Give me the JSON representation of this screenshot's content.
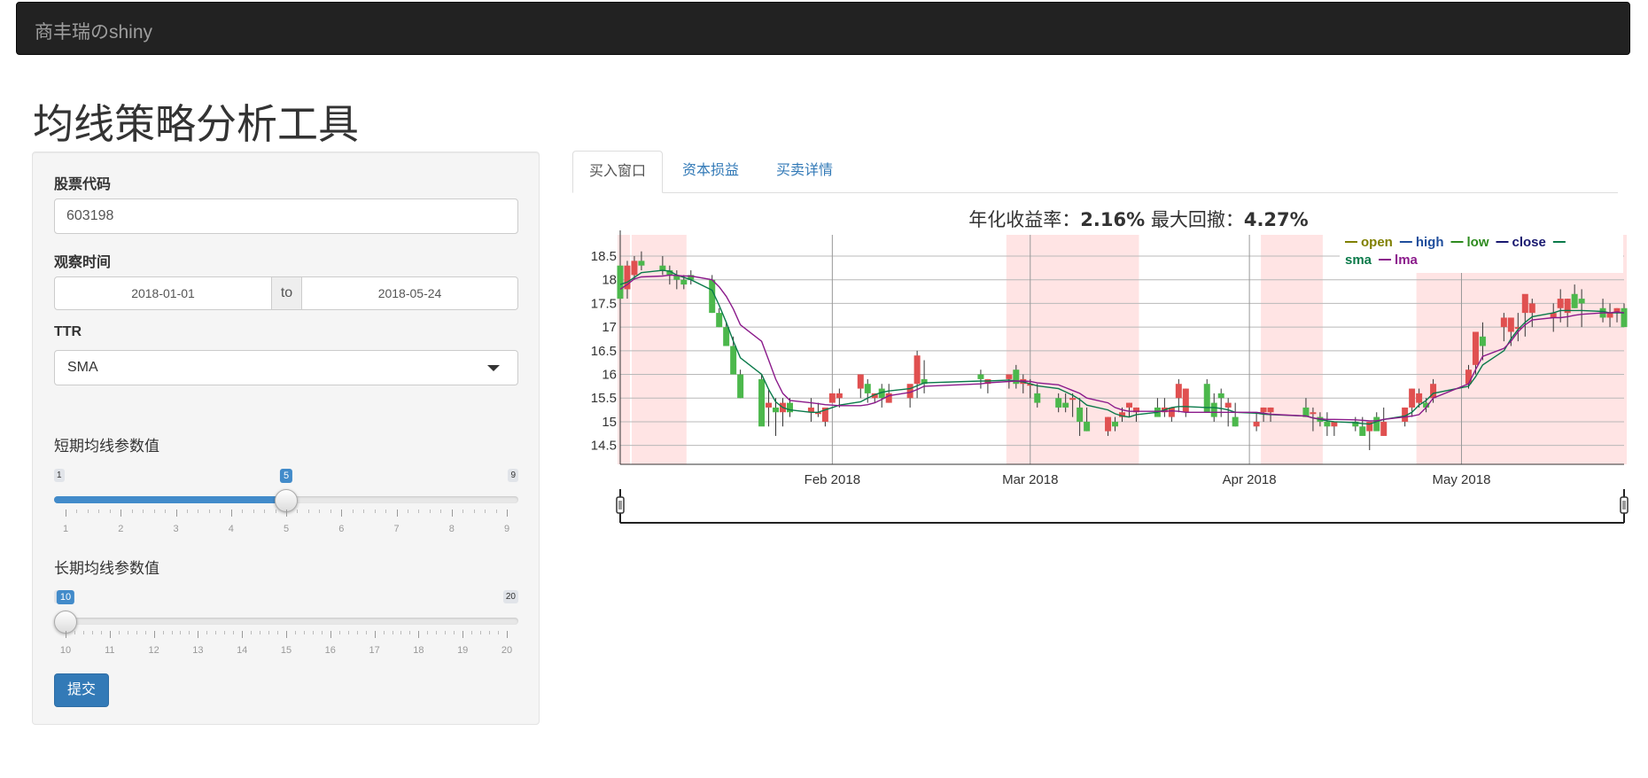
{
  "navbar": {
    "brand": "商丰瑞のshiny"
  },
  "page": {
    "title": "均线策略分析工具"
  },
  "sidebar": {
    "stock_code_label": "股票代码",
    "stock_code_value": "603198",
    "date_label": "观察时间",
    "date_start": "2018-01-01",
    "date_sep": "to",
    "date_end": "2018-05-24",
    "ttr_label": "TTR",
    "ttr_selected": "SMA",
    "short_label": "短期均线参数值",
    "short_slider": {
      "min": 1,
      "max": 9,
      "value": 5,
      "ticks": [
        "1",
        "2",
        "3",
        "4",
        "5",
        "6",
        "7",
        "8",
        "9"
      ]
    },
    "long_label": "长期均线参数值",
    "long_slider": {
      "min": 10,
      "max": 20,
      "value": 10,
      "ticks": [
        "10",
        "11",
        "12",
        "13",
        "14",
        "15",
        "16",
        "17",
        "18",
        "19",
        "20"
      ]
    },
    "submit_label": "提交"
  },
  "tabs": [
    {
      "label": "买入窗口",
      "active": true
    },
    {
      "label": "资本损益",
      "active": false
    },
    {
      "label": "买卖详情",
      "active": false
    }
  ],
  "chart_data": {
    "type": "candlestick",
    "title_prefix": "年化收益率：",
    "annual_return": "2.16%",
    "title_mid": " 最大回撤：",
    "max_drawdown": "4.27%",
    "legend": [
      {
        "name": "open",
        "color": "#808000"
      },
      {
        "name": "high",
        "color": "#1f4e9c"
      },
      {
        "name": "low",
        "color": "#2e8b1f"
      },
      {
        "name": "close",
        "color": "#191970"
      },
      {
        "name": "sma",
        "color": "#0a7a4a"
      },
      {
        "name": "lma",
        "color": "#8b1a8b"
      }
    ],
    "y_ticks": [
      "14.5",
      "15",
      "15.5",
      "16",
      "16.5",
      "17",
      "17.5",
      "18",
      "18.5"
    ],
    "ylim": [
      14.1,
      18.95
    ],
    "x_ticks": [
      {
        "label": "Feb 2018",
        "date": "2018-02-01"
      },
      {
        "label": "Mar 2018",
        "date": "2018-03-01"
      },
      {
        "label": "Apr 2018",
        "date": "2018-04-01"
      },
      {
        "label": "May 2018",
        "date": "2018-05-01"
      }
    ],
    "xlim": [
      "2018-01-02",
      "2018-05-24"
    ],
    "buy_windows": [
      [
        "2018-01-02",
        "2018-01-03"
      ],
      [
        "2018-01-04",
        "2018-01-11"
      ],
      [
        "2018-02-26",
        "2018-03-16"
      ],
      [
        "2018-04-03",
        "2018-04-11"
      ],
      [
        "2018-04-25",
        "2018-05-24"
      ]
    ],
    "dates": [
      "2018-01-02",
      "2018-01-03",
      "2018-01-04",
      "2018-01-05",
      "2018-01-08",
      "2018-01-09",
      "2018-01-10",
      "2018-01-11",
      "2018-01-12",
      "2018-01-15",
      "2018-01-16",
      "2018-01-17",
      "2018-01-18",
      "2018-01-19",
      "2018-01-22",
      "2018-01-23",
      "2018-01-24",
      "2018-01-25",
      "2018-01-26",
      "2018-01-29",
      "2018-01-30",
      "2018-01-31",
      "2018-02-01",
      "2018-02-02",
      "2018-02-05",
      "2018-02-06",
      "2018-02-07",
      "2018-02-08",
      "2018-02-09",
      "2018-02-12",
      "2018-02-13",
      "2018-02-14",
      "2018-02-22",
      "2018-02-23",
      "2018-02-26",
      "2018-02-27",
      "2018-02-28",
      "2018-03-01",
      "2018-03-02",
      "2018-03-05",
      "2018-03-06",
      "2018-03-07",
      "2018-03-08",
      "2018-03-09",
      "2018-03-12",
      "2018-03-13",
      "2018-03-14",
      "2018-03-15",
      "2018-03-16",
      "2018-03-19",
      "2018-03-20",
      "2018-03-21",
      "2018-03-22",
      "2018-03-23",
      "2018-03-26",
      "2018-03-27",
      "2018-03-28",
      "2018-03-29",
      "2018-03-30",
      "2018-04-02",
      "2018-04-03",
      "2018-04-04",
      "2018-04-09",
      "2018-04-10",
      "2018-04-11",
      "2018-04-12",
      "2018-04-13",
      "2018-04-16",
      "2018-04-17",
      "2018-04-18",
      "2018-04-19",
      "2018-04-20",
      "2018-04-23",
      "2018-04-24",
      "2018-04-25",
      "2018-04-26",
      "2018-04-27",
      "2018-05-02",
      "2018-05-03",
      "2018-05-04",
      "2018-05-07",
      "2018-05-08",
      "2018-05-09",
      "2018-05-10",
      "2018-05-11",
      "2018-05-14",
      "2018-05-15",
      "2018-05-16",
      "2018-05-17",
      "2018-05-18",
      "2018-05-21",
      "2018-05-22",
      "2018-05-23",
      "2018-05-24"
    ],
    "open": [
      18.3,
      17.8,
      18.1,
      18.4,
      18.3,
      18.2,
      18.1,
      18.0,
      18.1,
      18.0,
      17.3,
      17.0,
      16.6,
      16.0,
      15.9,
      15.3,
      15.3,
      15.2,
      15.4,
      15.2,
      15.2,
      15.0,
      15.4,
      15.5,
      15.7,
      15.8,
      15.5,
      15.7,
      15.4,
      15.5,
      15.8,
      15.9,
      16.0,
      15.8,
      15.9,
      16.1,
      15.8,
      15.8,
      15.6,
      15.5,
      15.4,
      15.5,
      15.3,
      15.0,
      14.8,
      15.0,
      15.1,
      15.3,
      15.2,
      15.3,
      15.2,
      15.1,
      15.5,
      15.2,
      15.8,
      15.4,
      15.6,
      15.3,
      15.1,
      14.9,
      15.2,
      15.2,
      15.3,
      15.2,
      15.1,
      15.0,
      14.9,
      15.0,
      14.9,
      14.8,
      15.1,
      14.7,
      15.0,
      15.3,
      15.4,
      15.4,
      15.5,
      15.8,
      16.2,
      16.8,
      17.0,
      16.9,
      17.0,
      17.3,
      17.3,
      17.2,
      17.4,
      17.3,
      17.7,
      17.6,
      17.4,
      17.2,
      17.3,
      17.4
    ],
    "high": [
      18.5,
      18.4,
      18.5,
      18.6,
      18.5,
      18.3,
      18.2,
      18.1,
      18.2,
      18.1,
      17.4,
      17.1,
      16.8,
      16.1,
      16.0,
      15.7,
      15.5,
      15.5,
      15.5,
      15.5,
      15.4,
      15.2,
      15.6,
      15.7,
      16.0,
      15.9,
      15.6,
      15.8,
      15.8,
      15.6,
      16.5,
      16.3,
      16.1,
      15.9,
      16.0,
      16.2,
      16.0,
      15.9,
      15.8,
      15.6,
      15.6,
      15.6,
      15.5,
      15.3,
      15.1,
      15.1,
      15.3,
      15.4,
      15.3,
      15.5,
      15.5,
      15.3,
      15.9,
      15.7,
      15.9,
      15.6,
      15.7,
      15.5,
      15.4,
      15.2,
      15.3,
      15.3,
      15.5,
      15.3,
      15.2,
      15.2,
      15.0,
      15.1,
      15.1,
      14.9,
      15.2,
      15.3,
      15.3,
      15.7,
      15.7,
      15.5,
      15.9,
      16.2,
      16.5,
      17.1,
      17.3,
      17.0,
      17.3,
      17.6,
      17.6,
      17.5,
      17.8,
      17.6,
      17.9,
      17.8,
      17.6,
      17.5,
      17.4,
      17.5
    ],
    "low": [
      17.6,
      17.6,
      18.0,
      18.2,
      18.1,
      17.9,
      17.8,
      17.8,
      17.9,
      17.3,
      17.0,
      16.6,
      16.0,
      15.5,
      15.0,
      14.9,
      14.7,
      14.9,
      15.1,
      15.0,
      15.1,
      14.9,
      15.4,
      15.3,
      15.5,
      15.4,
      15.4,
      15.3,
      15.4,
      15.3,
      15.5,
      15.6,
      15.7,
      15.6,
      15.7,
      15.7,
      15.6,
      15.5,
      15.3,
      15.2,
      15.2,
      15.1,
      14.7,
      14.8,
      14.7,
      14.8,
      15.0,
      15.1,
      15.0,
      15.2,
      15.1,
      15.0,
      15.2,
      15.1,
      15.2,
      15.0,
      15.1,
      14.9,
      14.9,
      14.8,
      15.0,
      15.0,
      15.1,
      14.8,
      14.9,
      14.7,
      14.7,
      14.8,
      14.8,
      14.4,
      14.9,
      14.7,
      14.9,
      15.1,
      15.3,
      15.2,
      15.4,
      15.7,
      16.0,
      16.3,
      16.7,
      16.6,
      16.7,
      16.8,
      17.0,
      16.9,
      17.1,
      17.0,
      17.4,
      17.0,
      17.1,
      17.0,
      17.1,
      17.0
    ],
    "close": [
      17.6,
      18.3,
      18.4,
      18.3,
      18.2,
      18.1,
      18.0,
      17.9,
      18.0,
      17.3,
      17.0,
      16.6,
      16.0,
      15.5,
      14.9,
      15.4,
      15.2,
      15.4,
      15.2,
      15.3,
      15.2,
      15.3,
      15.6,
      15.6,
      16.0,
      15.6,
      15.6,
      15.5,
      15.6,
      15.8,
      16.4,
      15.8,
      15.9,
      15.9,
      16.0,
      15.8,
      15.9,
      15.8,
      15.4,
      15.3,
      15.3,
      15.5,
      15.0,
      14.8,
      15.1,
      14.9,
      15.2,
      15.4,
      15.3,
      15.1,
      15.3,
      15.3,
      15.8,
      15.7,
      15.2,
      15.1,
      15.5,
      15.4,
      14.9,
      15.0,
      15.3,
      15.3,
      15.1,
      15.2,
      15.0,
      14.9,
      15.0,
      14.9,
      14.7,
      15.0,
      14.8,
      15.0,
      15.3,
      15.7,
      15.6,
      15.3,
      15.8,
      16.1,
      16.9,
      16.6,
      17.2,
      17.2,
      17.0,
      17.7,
      17.5,
      17.3,
      17.6,
      17.6,
      17.4,
      17.5,
      17.2,
      17.3,
      17.4,
      17.0
    ],
    "sma": [
      17.9,
      17.95,
      18.05,
      18.15,
      18.2,
      18.18,
      18.1,
      18.05,
      18.0,
      17.78,
      17.46,
      17.1,
      16.7,
      16.35,
      16.0,
      15.68,
      15.42,
      15.3,
      15.25,
      15.2,
      15.2,
      15.25,
      15.3,
      15.35,
      15.42,
      15.5,
      15.57,
      15.62,
      15.65,
      15.7,
      15.76,
      15.82,
      15.86,
      15.86,
      15.88,
      15.86,
      15.84,
      15.8,
      15.76,
      15.7,
      15.63,
      15.56,
      15.47,
      15.35,
      15.25,
      15.17,
      15.12,
      15.1,
      15.15,
      15.2,
      15.25,
      15.3,
      15.32,
      15.32,
      15.3,
      15.3,
      15.28,
      15.25,
      15.2,
      15.18,
      15.16,
      15.15,
      15.12,
      15.08,
      15.05,
      15.02,
      15.0,
      14.98,
      14.96,
      14.95,
      15.0,
      15.05,
      15.12,
      15.2,
      15.35,
      15.45,
      15.6,
      15.75,
      15.95,
      16.2,
      16.5,
      16.75,
      16.95,
      17.1,
      17.22,
      17.3,
      17.35,
      17.35,
      17.35,
      17.35,
      17.33,
      17.3,
      17.3,
      17.3
    ],
    "lma": [
      17.8,
      17.9,
      18.02,
      18.06,
      18.08,
      18.1,
      18.09,
      18.08,
      18.08,
      18.0,
      17.85,
      17.65,
      17.38,
      17.05,
      16.7,
      16.3,
      15.9,
      15.6,
      15.45,
      15.4,
      15.38,
      15.36,
      15.35,
      15.34,
      15.34,
      15.36,
      15.4,
      15.47,
      15.55,
      15.62,
      15.68,
      15.75,
      15.8,
      15.82,
      15.85,
      15.86,
      15.86,
      15.85,
      15.82,
      15.78,
      15.72,
      15.66,
      15.6,
      15.5,
      15.4,
      15.3,
      15.25,
      15.22,
      15.22,
      15.22,
      15.22,
      15.23,
      15.22,
      15.2,
      15.2,
      15.2,
      15.2,
      15.2,
      15.2,
      15.2,
      15.18,
      15.16,
      15.12,
      15.08,
      15.06,
      15.05,
      15.05,
      15.04,
      15.03,
      15.02,
      15.02,
      15.05,
      15.1,
      15.12,
      15.15,
      15.3,
      15.5,
      15.8,
      16.1,
      16.38,
      16.55,
      16.7,
      16.9,
      17.05,
      17.15,
      17.2,
      17.2,
      17.22,
      17.25,
      17.27,
      17.3,
      17.3,
      17.32,
      17.3
    ]
  }
}
